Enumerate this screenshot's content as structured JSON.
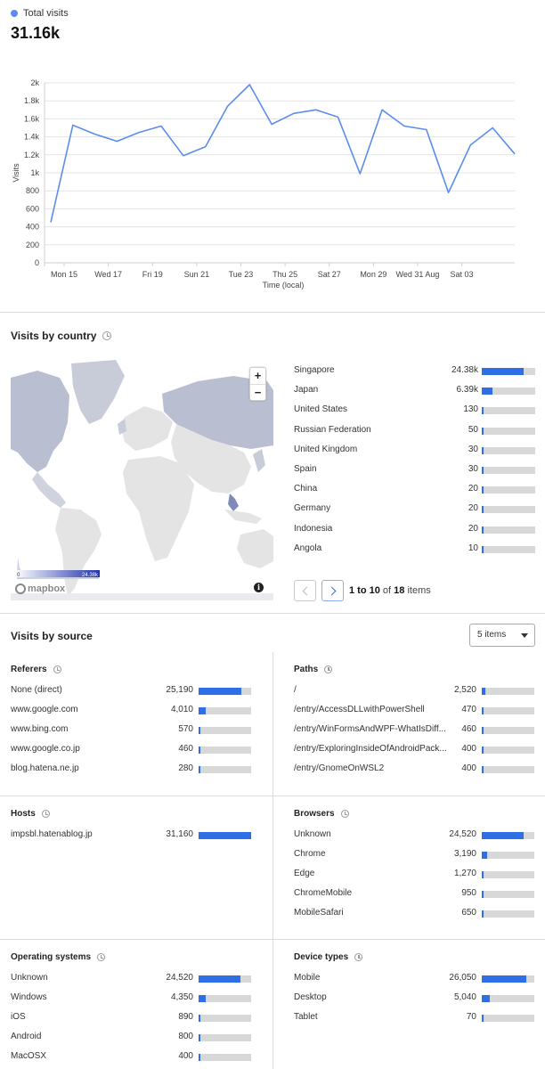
{
  "summary": {
    "legend": "Total visits",
    "total": "31.16k",
    "color": "#5b8def"
  },
  "chart_data": {
    "type": "line",
    "ylabel": "Visits",
    "xlabel": "Time (local)",
    "yticks": [
      "0",
      "200",
      "400",
      "600",
      "800",
      "1k",
      "1.2k",
      "1.4k",
      "1.6k",
      "1.8k",
      "2k"
    ],
    "ylim": [
      0,
      2000
    ],
    "xticks": [
      "Mon 15",
      "Wed 17",
      "Fri 19",
      "Sun 21",
      "Tue 23",
      "Thu 25",
      "Sat 27",
      "Mon 29",
      "Wed 31 Aug",
      "Sat 03"
    ],
    "series": [
      {
        "values": [
          450,
          1530,
          1430,
          1350,
          1450,
          1520,
          1190,
          1290,
          1740,
          1980,
          1540,
          1660,
          1700,
          1620,
          990,
          1700,
          1520,
          1480,
          780,
          1310,
          1500,
          1210
        ]
      }
    ],
    "grid": true
  },
  "country": {
    "title": "Visits by country",
    "rows": [
      {
        "label": "Singapore",
        "value": "24.38k",
        "ratio": 0.78
      },
      {
        "label": "Japan",
        "value": "6.39k",
        "ratio": 0.2
      },
      {
        "label": "United States",
        "value": "130",
        "ratio": 0.004
      },
      {
        "label": "Russian Federation",
        "value": "50",
        "ratio": 0.002
      },
      {
        "label": "United Kingdom",
        "value": "30",
        "ratio": 0.001
      },
      {
        "label": "Spain",
        "value": "30",
        "ratio": 0.001
      },
      {
        "label": "China",
        "value": "20",
        "ratio": 0.001
      },
      {
        "label": "Germany",
        "value": "20",
        "ratio": 0.001
      },
      {
        "label": "Indonesia",
        "value": "20",
        "ratio": 0.001
      },
      {
        "label": "Angola",
        "value": "10",
        "ratio": 0.0005
      }
    ],
    "map": {
      "zoom_in": "+",
      "zoom_out": "−",
      "legend_min": "0",
      "legend_max": "24.38k",
      "brand": "mapbox",
      "info": "i"
    },
    "pager": {
      "range": "1 to 10",
      "of": "of",
      "total": "18",
      "items": "items"
    }
  },
  "source": {
    "title": "Visits by source",
    "select_value": "5 items",
    "referers": {
      "title": "Referers",
      "rows": [
        {
          "label": "None (direct)",
          "value": "25,190",
          "ratio": 0.81
        },
        {
          "label": "www.google.com",
          "value": "4,010",
          "ratio": 0.13
        },
        {
          "label": "www.bing.com",
          "value": "570",
          "ratio": 0.02
        },
        {
          "label": "www.google.co.jp",
          "value": "460",
          "ratio": 0.015
        },
        {
          "label": "blog.hatena.ne.jp",
          "value": "280",
          "ratio": 0.009
        }
      ]
    },
    "paths": {
      "title": "Paths",
      "rows": [
        {
          "label": "/",
          "value": "2,520",
          "ratio": 0.06
        },
        {
          "label": "/entry/AccessDLLwithPowerShell",
          "value": "470",
          "ratio": 0.012
        },
        {
          "label": "/entry/WinFormsAndWPF-WhatIsDiff...",
          "value": "460",
          "ratio": 0.012
        },
        {
          "label": "/entry/ExploringInsideOfAndroidPack...",
          "value": "400",
          "ratio": 0.01
        },
        {
          "label": "/entry/GnomeOnWSL2",
          "value": "400",
          "ratio": 0.01
        }
      ]
    },
    "hosts": {
      "title": "Hosts",
      "rows": [
        {
          "label": "impsbl.hatenablog.jp",
          "value": "31,160",
          "ratio": 1.0
        }
      ]
    },
    "browsers": {
      "title": "Browsers",
      "rows": [
        {
          "label": "Unknown",
          "value": "24,520",
          "ratio": 0.79
        },
        {
          "label": "Chrome",
          "value": "3,190",
          "ratio": 0.1
        },
        {
          "label": "Edge",
          "value": "1,270",
          "ratio": 0.04
        },
        {
          "label": "ChromeMobile",
          "value": "950",
          "ratio": 0.03
        },
        {
          "label": "MobileSafari",
          "value": "650",
          "ratio": 0.02
        }
      ]
    },
    "os": {
      "title": "Operating systems",
      "rows": [
        {
          "label": "Unknown",
          "value": "24,520",
          "ratio": 0.79
        },
        {
          "label": "Windows",
          "value": "4,350",
          "ratio": 0.14
        },
        {
          "label": "iOS",
          "value": "890",
          "ratio": 0.03
        },
        {
          "label": "Android",
          "value": "800",
          "ratio": 0.026
        },
        {
          "label": "MacOSX",
          "value": "400",
          "ratio": 0.013
        }
      ]
    },
    "devices": {
      "title": "Device types",
      "rows": [
        {
          "label": "Mobile",
          "value": "26,050",
          "ratio": 0.84
        },
        {
          "label": "Desktop",
          "value": "5,040",
          "ratio": 0.16
        },
        {
          "label": "Tablet",
          "value": "70",
          "ratio": 0.002
        }
      ]
    }
  },
  "colors": {
    "bar_fill": "#2f6fe6",
    "bar_track": "#d8d8d8",
    "line": "#5b8def",
    "map_land": "#e4e4e4",
    "map_highlight": "#b9bfd0"
  }
}
